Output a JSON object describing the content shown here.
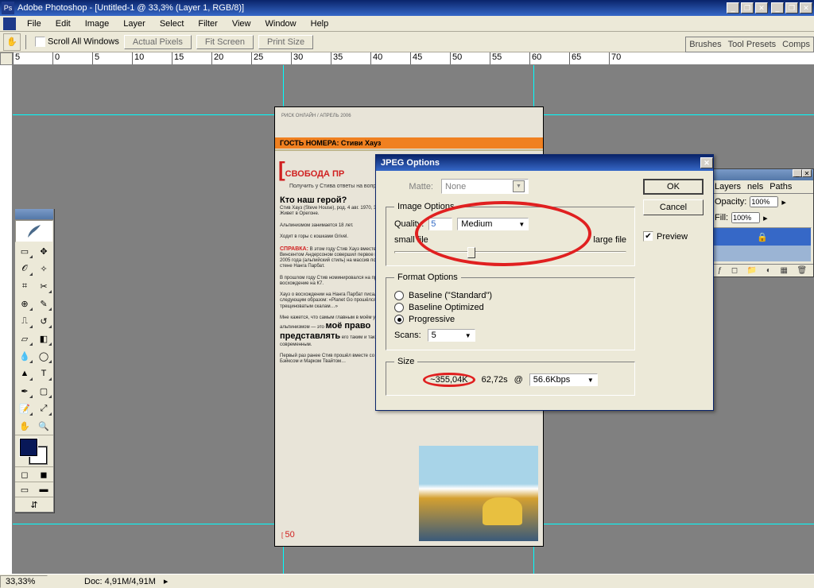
{
  "app": {
    "title": "Adobe Photoshop - [Untitled-1 @ 33,3% (Layer 1, RGB/8)]",
    "icon_label": "Ps"
  },
  "menu": [
    "File",
    "Edit",
    "Image",
    "Layer",
    "Select",
    "Filter",
    "View",
    "Window",
    "Help"
  ],
  "optbar": {
    "scroll_all": "Scroll All Windows",
    "actual": "Actual Pixels",
    "fit": "Fit Screen",
    "print": "Print Size"
  },
  "panel_tabs": [
    "Brushes",
    "Tool Presets",
    "Comps"
  ],
  "layers": {
    "tabs": [
      "Layers",
      "nels",
      "Paths"
    ],
    "opacity_label": "Opacity:",
    "opacity": "100%",
    "fill_label": "Fill:",
    "fill": "100%",
    "lock_icon": "🔒"
  },
  "ruler_h": [
    "5",
    "0",
    "5",
    "10",
    "15",
    "20",
    "25",
    "30",
    "35",
    "40",
    "45",
    "50",
    "55",
    "60",
    "65",
    "70"
  ],
  "status": {
    "zoom": "33,33%",
    "doc": "Doc: 4,91M/4,91M"
  },
  "document": {
    "guest": "ГОСТЬ НОМЕРА: Стиви Хауз",
    "title": "СВОБОДА ПР",
    "spravka": "СПРАВКА:",
    "page": "50"
  },
  "dialog": {
    "title": "JPEG Options",
    "ok": "OK",
    "cancel": "Cancel",
    "preview": "Preview",
    "matte_label": "Matte:",
    "matte_value": "None",
    "image_options": "Image Options",
    "quality_label": "Quality:",
    "quality_value": "5",
    "quality_preset": "Medium",
    "small_file": "small file",
    "large_file": "large file",
    "format_options": "Format Options",
    "radios": [
      "Baseline (\"Standard\")",
      "Baseline Optimized",
      "Progressive"
    ],
    "radio_selected": 2,
    "scans_label": "Scans:",
    "scans_value": "5",
    "size_legend": "Size",
    "size_kb": "~355,04K",
    "size_sec": "62,72s",
    "at": "@",
    "speed": "56.6Kbps"
  },
  "tools": [
    [
      "move",
      "marquee"
    ],
    [
      "lasso",
      "wand"
    ],
    [
      "crop",
      "slice"
    ],
    [
      "heal",
      "brush"
    ],
    [
      "stamp",
      "history"
    ],
    [
      "eraser",
      "gradient"
    ],
    [
      "blur",
      "dodge"
    ],
    [
      "path",
      "type"
    ],
    [
      "pen",
      "shape"
    ],
    [
      "notes",
      "eyedrop"
    ],
    [
      "hand",
      "zoom"
    ]
  ]
}
